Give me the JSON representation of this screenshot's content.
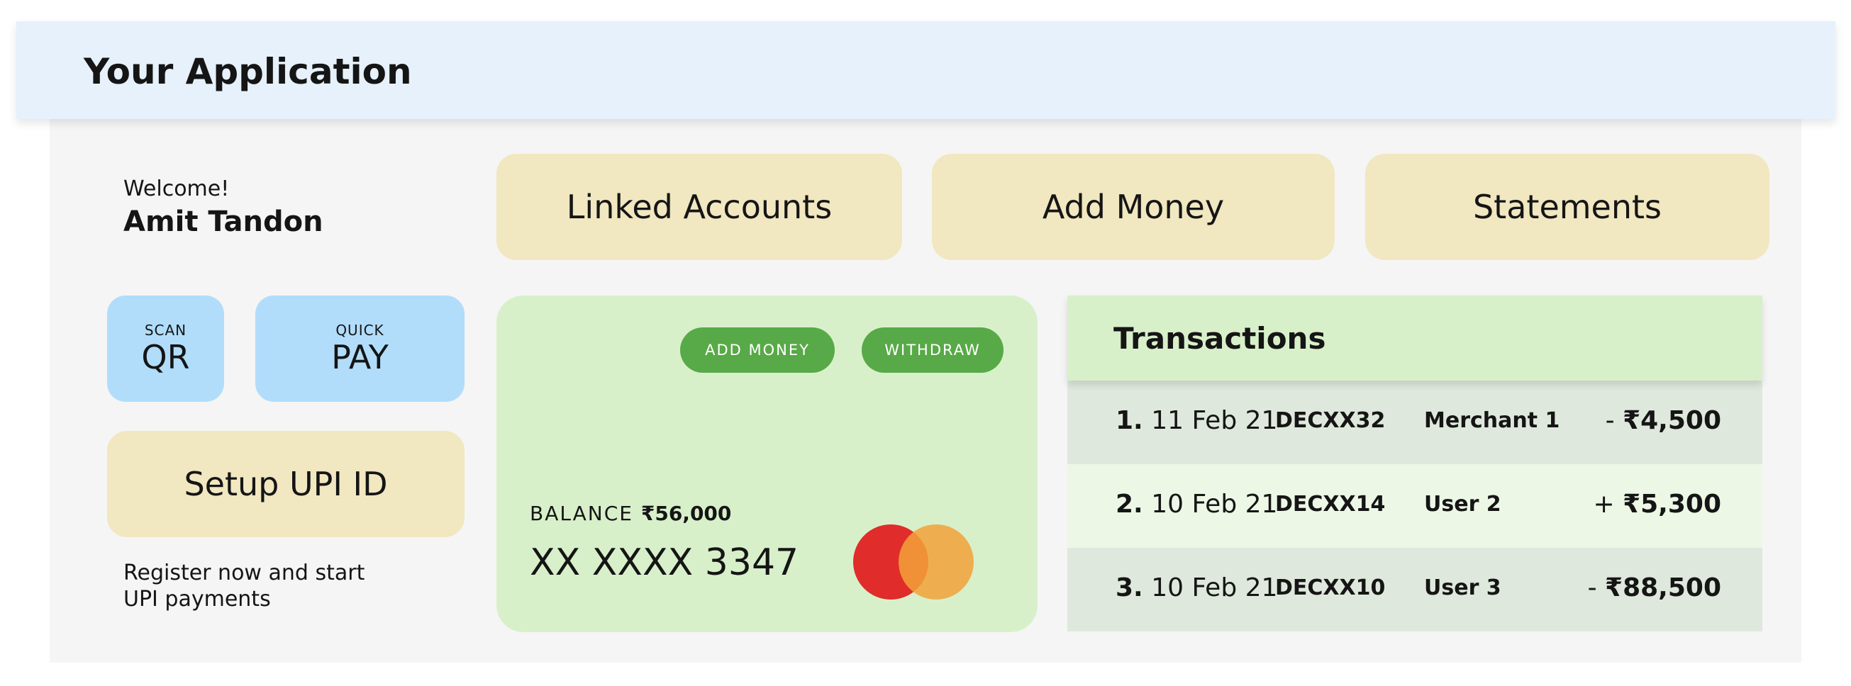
{
  "app": {
    "title": "Your Application"
  },
  "user": {
    "greeting": "Welcome!",
    "name": "Amit Tandon"
  },
  "nav_buttons": [
    {
      "label": "Linked Accounts"
    },
    {
      "label": "Add Money"
    },
    {
      "label": "Statements"
    }
  ],
  "quick_actions": {
    "scan": {
      "small": "SCAN",
      "big": "QR"
    },
    "pay": {
      "small": "QUICK",
      "big": "PAY"
    }
  },
  "upi": {
    "setup_label": "Setup UPI ID",
    "register_line1": "Register now and start",
    "register_line2": "UPI payments"
  },
  "card": {
    "add_money_label": "ADD MONEY",
    "withdraw_label": "WITHDRAW",
    "balance_label": "BALANCE",
    "balance_value": "₹56,000",
    "number": "XX XXXX 3347",
    "logo_icon": "mastercard-logo-icon"
  },
  "transactions": {
    "title": "Transactions",
    "rows": [
      {
        "index": "1.",
        "date": "11 Feb 21",
        "ref": "DECXX32",
        "party": "Merchant 1",
        "sign": "- ",
        "amount": "₹4,500"
      },
      {
        "index": "2.",
        "date": "10 Feb 21",
        "ref": "DECXX14",
        "party": "User 2",
        "sign": "+ ",
        "amount": "₹5,300"
      },
      {
        "index": "3.",
        "date": "10 Feb 21",
        "ref": "DECXX10",
        "party": "User 3",
        "sign": "- ",
        "amount": "₹88,500"
      }
    ]
  },
  "colors": {
    "header_bg": "#e6f1fb",
    "main_bg": "#f5f5f5",
    "pill_bg": "#f1e7c0",
    "quick_bg": "#b1ddfb",
    "card_bg": "#d8f0ca",
    "card_button": "#58a947",
    "tx_row_dark": "#dfe8dc",
    "tx_row_light": "#ecf7e6",
    "mc_red": "#e02c2a",
    "mc_orange": "#f2a23a"
  }
}
